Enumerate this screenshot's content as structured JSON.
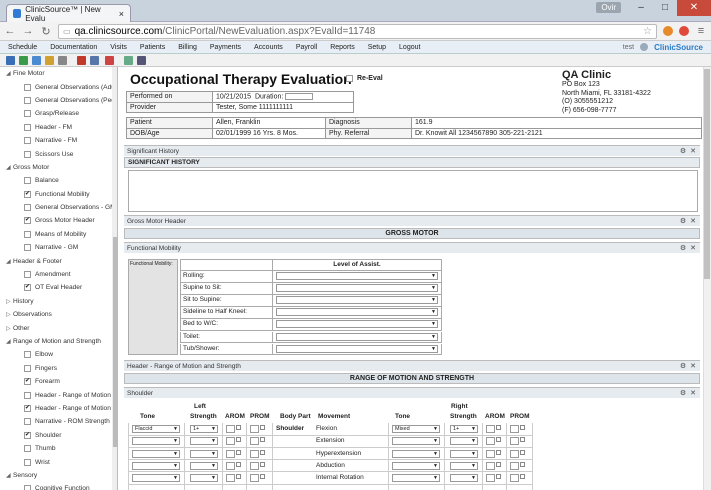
{
  "browser": {
    "tab_title": "ClinicSource™ | New Evalu",
    "owner_label": "Ovir",
    "url_host": "qa.clinicsource.com",
    "url_path": "/ClinicPortal/NewEvaluation.aspx?EvalId=11748"
  },
  "menu": {
    "items": [
      "Schedule",
      "Documentation",
      "Visits",
      "Patients",
      "Billing",
      "Payments",
      "Accounts",
      "Payroll",
      "Reports",
      "Setup",
      "Logout"
    ],
    "user": "test",
    "logo": "ClinicSource"
  },
  "sidebar": [
    {
      "type": "group",
      "label": "Fine Motor",
      "open": true
    },
    {
      "type": "item",
      "label": "General Observations (Adu",
      "checked": false
    },
    {
      "type": "item",
      "label": "General Observations (Ped)",
      "checked": false
    },
    {
      "type": "item",
      "label": "Grasp/Release",
      "checked": false
    },
    {
      "type": "item",
      "label": "Header - FM",
      "checked": false
    },
    {
      "type": "item",
      "label": "Narrative - FM",
      "checked": false
    },
    {
      "type": "item",
      "label": "Scissors Use",
      "checked": false
    },
    {
      "type": "group",
      "label": "Gross Motor",
      "open": true
    },
    {
      "type": "item",
      "label": "Balance",
      "checked": false
    },
    {
      "type": "item",
      "label": "Functional Mobility",
      "checked": true
    },
    {
      "type": "item",
      "label": "General Observations - GM",
      "checked": false
    },
    {
      "type": "item",
      "label": "Gross Motor Header",
      "checked": true
    },
    {
      "type": "item",
      "label": "Means of Mobility",
      "checked": false
    },
    {
      "type": "item",
      "label": "Narrative - GM",
      "checked": false
    },
    {
      "type": "group",
      "label": "Header & Footer",
      "open": true
    },
    {
      "type": "item",
      "label": "Amendment",
      "checked": false
    },
    {
      "type": "item",
      "label": "OT Eval Header",
      "checked": true
    },
    {
      "type": "group",
      "label": "History",
      "open": false
    },
    {
      "type": "group",
      "label": "Observations",
      "open": false
    },
    {
      "type": "group",
      "label": "Other",
      "open": false
    },
    {
      "type": "group",
      "label": "Range of Motion and Strength",
      "open": true
    },
    {
      "type": "item",
      "label": "Elbow",
      "checked": false
    },
    {
      "type": "item",
      "label": "Fingers",
      "checked": false
    },
    {
      "type": "item",
      "label": "Forearm",
      "checked": true
    },
    {
      "type": "item",
      "label": "Header - Range of Motion",
      "checked": false
    },
    {
      "type": "item",
      "label": "Header - Range of Motion",
      "checked": true
    },
    {
      "type": "item",
      "label": "Narrative - ROM Strength",
      "checked": false
    },
    {
      "type": "item",
      "label": "Shoulder",
      "checked": true
    },
    {
      "type": "item",
      "label": "Thumb",
      "checked": false
    },
    {
      "type": "item",
      "label": "Wrist",
      "checked": false
    },
    {
      "type": "group",
      "label": "Sensory",
      "open": true
    },
    {
      "type": "item",
      "label": "Cognitive Function",
      "checked": false
    }
  ],
  "header": {
    "title": "Occupational Therapy Evaluation",
    "reeval_label": "Re-Eval",
    "clinic_name": "QA Clinic",
    "clinic_lines": [
      "PO Box 123",
      "North Miami, FL 33181-4322",
      "(O) 3055551212",
      "(F) 656-098-7777"
    ],
    "performed_on_label": "Performed on",
    "performed_on_value": "10/21/2015",
    "duration_label": "Duration:",
    "provider_label": "Provider",
    "provider_value": "Tester, Some   1111111111",
    "patient_label": "Patient",
    "patient_value": "Allen, Franklin",
    "diagnosis_label": "Diagnosis",
    "diagnosis_value": "161.9",
    "dob_label": "DOB/Age",
    "dob_value": "02/01/1999  16 Yrs. 8 Mos.",
    "referral_label": "Phy. Referral",
    "referral_value": "Dr. Knowit All  1234567890 305-221-2121"
  },
  "sections": {
    "significant_history_bar": "Significant History",
    "significant_history_band": "SIGNIFICANT HISTORY",
    "gross_motor_bar": "Gross Motor Header",
    "gross_motor_band": "GROSS MOTOR",
    "functional_mobility_bar": "Functional Mobility",
    "functional_mobility_small": "Functional Mobility:",
    "level_header": "Level of Assist.",
    "fm_rows": [
      "Rolling:",
      "Supine to Sit:",
      "Sit to Supine:",
      "Sideline to Half Kneel:",
      "Bed to W/C:",
      "Toilet:",
      "Tub/Shower:"
    ],
    "rom_bar": "Header - Range of Motion and Strength",
    "rom_band": "RANGE OF MOTION AND STRENGTH",
    "shoulder_bar": "Shoulder"
  },
  "rom": {
    "left_label": "Left",
    "right_label": "Right",
    "cols_left": [
      "Tone",
      "Strength",
      "AROM",
      "PROM"
    ],
    "body_part_label": "Body Part",
    "movement_label": "Movement",
    "cols_right": [
      "Tone",
      "Strength",
      "AROM",
      "PROM"
    ],
    "body_part": "Shoulder",
    "movements": [
      "Flexion",
      "Extension",
      "Hyperextension",
      "Abduction",
      "Internal Rotation"
    ],
    "left_tone_first": "Flaccid",
    "left_strength_first": "1+",
    "right_tone_first": "Mixed",
    "right_strength_first": "1+"
  }
}
